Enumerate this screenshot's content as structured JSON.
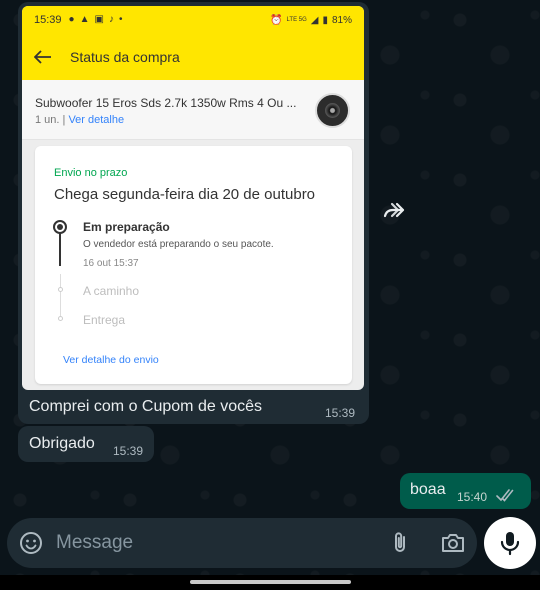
{
  "screenshot": {
    "status_bar": {
      "time": "15:39",
      "notification_icons": [
        "chat-icon",
        "app-icon",
        "mail-icon",
        "tiktok-icon",
        "dot-icon"
      ],
      "right_text": "81%",
      "network_text": "LTE 5G"
    },
    "app_bar": {
      "title": "Status da compra"
    },
    "product": {
      "name": "Subwoofer 15 Eros Sds 2.7k 1350w Rms 4 Ou ...",
      "quantity": "1 un.",
      "separator": " | ",
      "detail_link": "Ver detalhe"
    },
    "shipment": {
      "status_label": "Envio no prazo",
      "arrival": "Chega segunda-feira dia 20 de outubro",
      "steps": [
        {
          "title": "Em preparação",
          "description": "O vendedor está preparando o seu pacote.",
          "time": "16 out 15:37"
        },
        {
          "title": "A caminho"
        },
        {
          "title": "Entrega"
        }
      ],
      "detail_link": "Ver detalhe do envio"
    }
  },
  "messages": [
    {
      "text": "Comprei com o Cupom de vocês",
      "time": "15:39",
      "direction": "in"
    },
    {
      "text": "Obrigado",
      "time": "15:39",
      "direction": "in"
    },
    {
      "text": "boaa",
      "time": "15:40",
      "direction": "out",
      "status": "read"
    }
  ],
  "composer": {
    "placeholder": "Message"
  },
  "colors": {
    "yellow": "#ffe600",
    "incoming_bubble": "#1f2c34",
    "outgoing_bubble": "#005c4b",
    "link_blue": "#3483fa",
    "green_status": "#00a650"
  }
}
